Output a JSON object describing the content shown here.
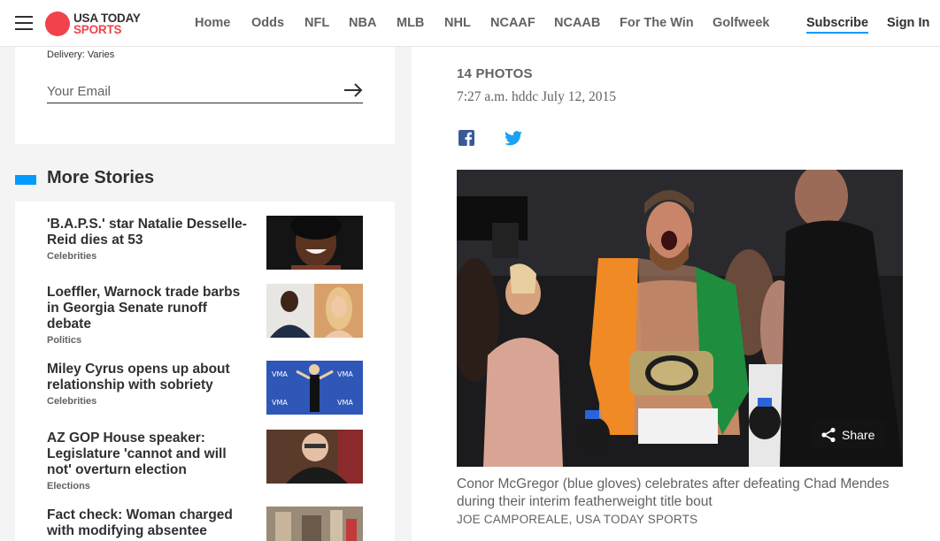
{
  "brand": {
    "line1": "USA TODAY",
    "line2": "SPORTS",
    "accent": "#f2424b",
    "blue": "#009bff"
  },
  "nav": {
    "items": [
      "Home",
      "Odds",
      "NFL",
      "NBA",
      "MLB",
      "NHL",
      "NCAAF",
      "NCAAB",
      "For The Win",
      "Golfweek"
    ],
    "subscribe": "Subscribe",
    "signin": "Sign In"
  },
  "newsletter": {
    "delivery": "Delivery: Varies",
    "email_placeholder": "Your Email"
  },
  "more_stories": {
    "title": "More Stories",
    "items": [
      {
        "headline": "'B.A.P.S.' star Natalie Desselle-Reid dies at 53",
        "category": "Celebrities"
      },
      {
        "headline": "Loeffler, Warnock trade barbs in Georgia Senate runoff debate",
        "category": "Politics"
      },
      {
        "headline": "Miley Cyrus opens up about relationship with sobriety",
        "category": "Celebrities"
      },
      {
        "headline": "AZ GOP House speaker: Legislature 'cannot and will not' overturn election",
        "category": "Elections"
      },
      {
        "headline": "Fact check: Woman charged with modifying absentee",
        "category": ""
      }
    ]
  },
  "gallery": {
    "count": "14 PHOTOS",
    "timestamp": "7:27 a.m. hddc July 12, 2015",
    "share_label": "Share",
    "caption": "Conor McGregor (blue gloves) celebrates after defeating Chad Mendes during their interim featherweight title bout",
    "credit": "JOE CAMPOREALE, USA TODAY SPORTS"
  },
  "icons": {
    "menu": "hamburger-menu-icon",
    "arrow": "arrow-right-icon",
    "facebook": "facebook-icon",
    "twitter": "twitter-icon",
    "share": "share-icon"
  }
}
